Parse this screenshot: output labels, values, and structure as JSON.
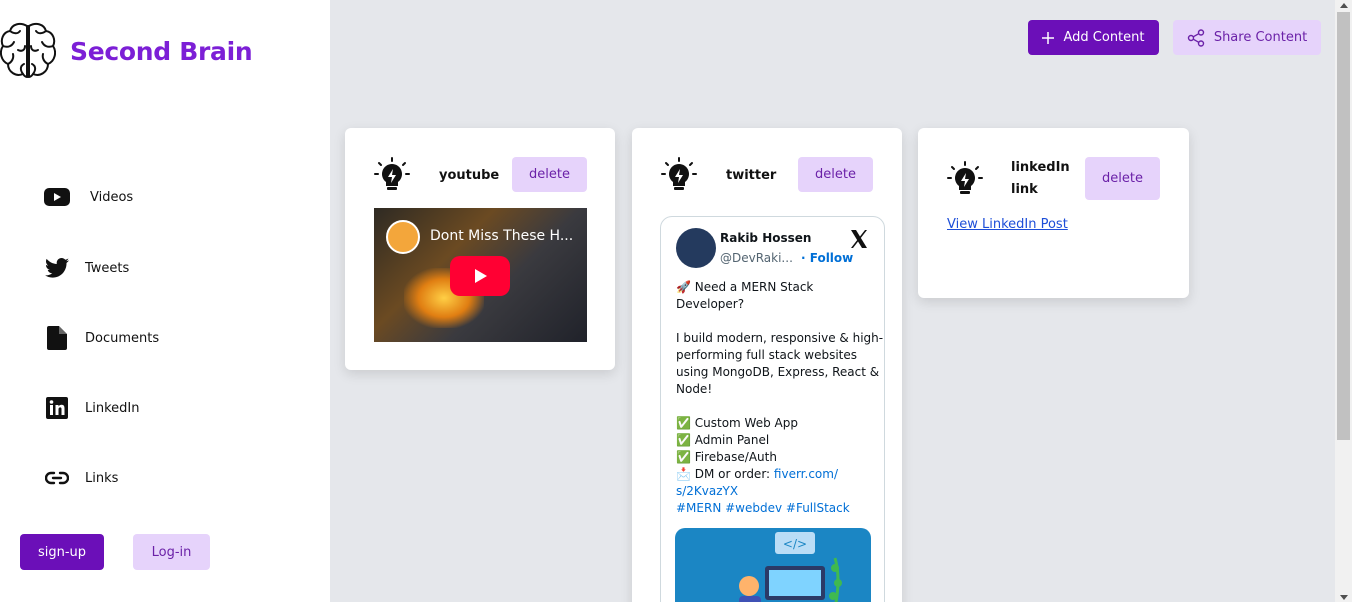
{
  "app": {
    "title": "Second Brain"
  },
  "sidebar": {
    "items": [
      {
        "label": "Videos",
        "icon": "youtube-icon"
      },
      {
        "label": "Tweets",
        "icon": "twitter-icon"
      },
      {
        "label": "Documents",
        "icon": "document-icon"
      },
      {
        "label": "LinkedIn",
        "icon": "linkedin-icon"
      },
      {
        "label": "Links",
        "icon": "link-icon"
      }
    ],
    "signup_label": "sign-up",
    "login_label": "Log-in"
  },
  "toolbar": {
    "add_label": "Add Content",
    "share_label": "Share Content"
  },
  "colors": {
    "primary": "#6b0fb8",
    "secondary": "#e6d3fb",
    "brand_text": "#7c1fd6",
    "background": "#e5e7eb"
  },
  "cards": [
    {
      "title": "youtube",
      "delete_label": "delete",
      "video_title": "Dont Miss These H..."
    },
    {
      "title": "twitter",
      "delete_label": "delete",
      "tweet": {
        "author_name": "Rakib Hossen",
        "author_handle": "@DevRaki...",
        "follow_label": "· Follow",
        "lines": [
          "🚀 Need a MERN Stack",
          "Developer?",
          "",
          "I build modern, responsive & high-",
          "performing full stack websites",
          "using MongoDB, Express, React &",
          "Node!",
          "",
          "✅ Custom Web App",
          "✅ Admin Panel",
          "✅ Firebase/Auth"
        ],
        "dm_prefix": "📩 DM or order: ",
        "dm_link_1": "fiverr.com/",
        "dm_link_2": "s/2KvazYX",
        "hashtags": "#MERN #webdev #FullStack"
      }
    },
    {
      "title_line1": "linkedIn",
      "title_line2": "link",
      "delete_label": "delete",
      "link_text": "View LinkedIn Post"
    }
  ]
}
